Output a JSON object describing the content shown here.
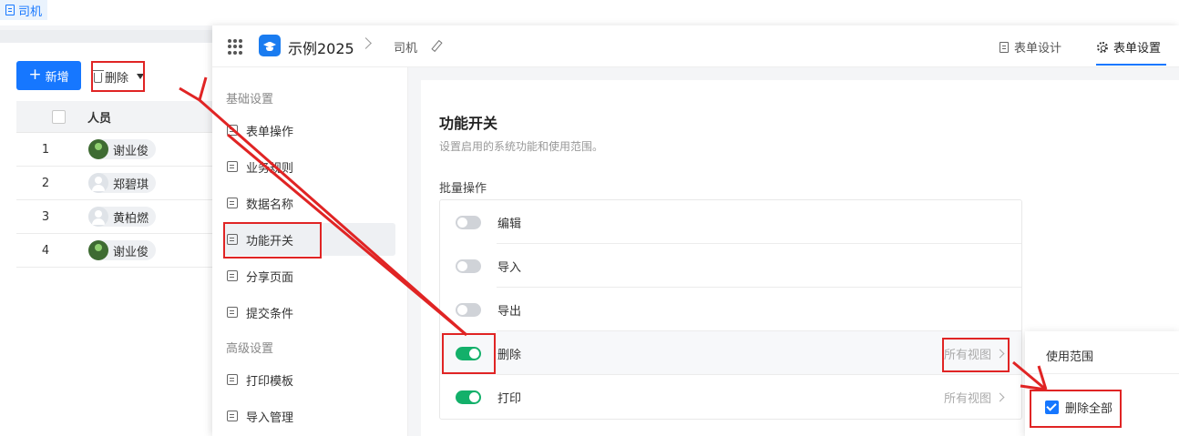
{
  "page_tab": {
    "label": "司机"
  },
  "toolbar": {
    "add_label": "新增",
    "delete_label": "删除"
  },
  "table": {
    "header": "人员",
    "rows": [
      {
        "index": "1",
        "name": "谢业俊",
        "avatar": "green"
      },
      {
        "index": "2",
        "name": "郑碧琪",
        "avatar": "grey"
      },
      {
        "index": "3",
        "name": "黄柏燃",
        "avatar": "grey"
      },
      {
        "index": "4",
        "name": "谢业俊",
        "avatar": "green"
      }
    ]
  },
  "modal": {
    "app_name": "示例2025",
    "form_name": "司机",
    "tabs": [
      {
        "label": "表单设计",
        "active": false
      },
      {
        "label": "表单设置",
        "active": true
      }
    ],
    "sidebar": {
      "groups": [
        {
          "label": "基础设置",
          "items": [
            {
              "label": "表单操作",
              "icon": "form-ops-icon"
            },
            {
              "label": "业务规则",
              "icon": "rules-icon"
            },
            {
              "label": "数据名称",
              "icon": "data-name-icon"
            },
            {
              "label": "功能开关",
              "icon": "switch-icon",
              "active": true
            },
            {
              "label": "分享页面",
              "icon": "share-icon"
            },
            {
              "label": "提交条件",
              "icon": "submit-icon"
            }
          ]
        },
        {
          "label": "高级设置",
          "items": [
            {
              "label": "打印模板",
              "icon": "print-icon"
            },
            {
              "label": "导入管理",
              "icon": "import-icon"
            }
          ]
        }
      ]
    },
    "panel": {
      "title": "功能开关",
      "subtitle": "设置启用的系统功能和使用范围。",
      "section_label": "批量操作",
      "operations": [
        {
          "label": "编辑",
          "enabled": false,
          "scope": ""
        },
        {
          "label": "导入",
          "enabled": false,
          "scope": ""
        },
        {
          "label": "导出",
          "enabled": false,
          "scope": ""
        },
        {
          "label": "删除",
          "enabled": true,
          "scope": "所有视图"
        },
        {
          "label": "打印",
          "enabled": true,
          "scope": "所有视图"
        }
      ]
    },
    "popover": {
      "title": "使用范围",
      "option_label": "删除全部",
      "option_checked": true
    }
  },
  "colors": {
    "accent": "#1677ff",
    "toggle_on": "#13b06a",
    "annotation": "#e02424"
  }
}
